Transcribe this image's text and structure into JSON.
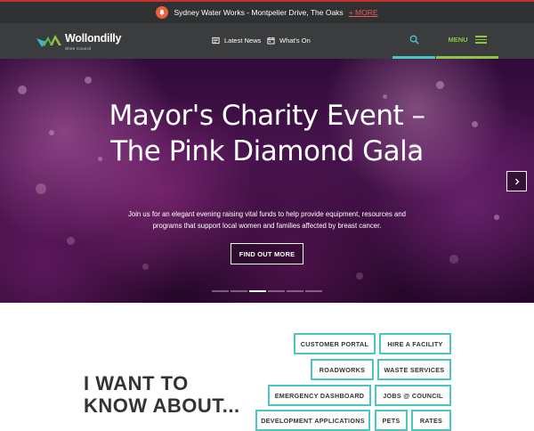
{
  "alert": {
    "text": "Sydney Water Works - Montpelier Drive, The Oaks",
    "more_label": "+ MORE",
    "icon": "bell-icon",
    "accent": "#e8613a"
  },
  "header": {
    "logo_name": "Wollondilly",
    "logo_sub": "Shire Council",
    "nav": [
      {
        "label": "Latest News",
        "icon": "news-icon"
      },
      {
        "label": "What's On",
        "icon": "calendar-icon"
      }
    ],
    "search_icon": "search-icon",
    "menu_label": "MENU",
    "colors": {
      "bar": "#3a3c3e",
      "search_accent": "#4cc6c2",
      "menu_accent": "#8cc63e"
    }
  },
  "hero": {
    "title": "Mayor's Charity Event – The Pink Diamond Gala",
    "description": "Join us for an elegant evening raising vital funds to help provide equipment, resources and programs that support local women and families affected by breast cancer.",
    "button_label": "FIND OUT MORE",
    "next_icon": "chevron-right-icon",
    "slide_count": 6,
    "active_slide": 3
  },
  "know_about": {
    "title": "I WANT TO KNOW ABOUT...",
    "links": [
      "CUSTOMER PORTAL",
      "HIRE A FACILITY",
      "ROADWORKS",
      "WASTE SERVICES",
      "EMERGENCY DASHBOARD",
      "JOBS @ COUNCIL",
      "DEVELOPMENT APPLICATIONS",
      "PETS",
      "RATES"
    ],
    "accent": "#4cc6c2"
  }
}
